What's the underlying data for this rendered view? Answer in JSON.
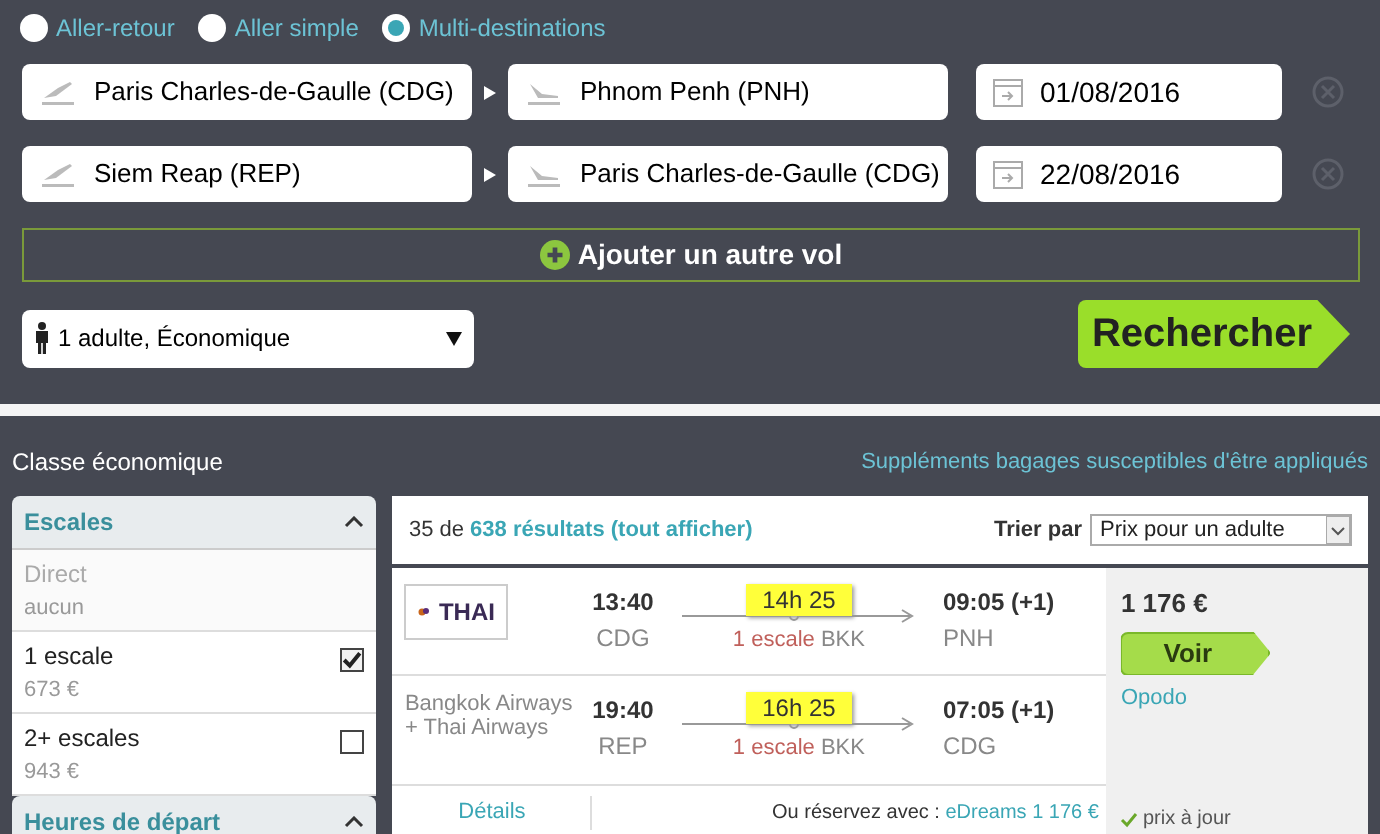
{
  "trip_types": [
    {
      "label": "Aller-retour",
      "selected": false
    },
    {
      "label": "Aller simple",
      "selected": false
    },
    {
      "label": "Multi-destinations",
      "selected": true
    }
  ],
  "flights": [
    {
      "from": "Paris Charles-de-Gaulle (CDG)",
      "to": "Phnom Penh (PNH)",
      "date": "01/08/2016"
    },
    {
      "from": "Siem Reap (REP)",
      "to": "Paris Charles-de-Gaulle (CDG)",
      "date": "22/08/2016"
    }
  ],
  "add_flight": "Ajouter un autre vol",
  "passengers": "1 adulte, Économique",
  "search_button": "Rechercher",
  "cabin_class": "Classe économique",
  "baggage_note": "Suppléments bagages susceptibles d'être appliqués",
  "filters": [
    {
      "title": "Escales",
      "expanded": true,
      "options": [
        {
          "label": "Direct",
          "price": "aucun",
          "disabled": true
        },
        {
          "label": "1 escale",
          "price": "673 €",
          "disabled": false,
          "checked": true
        },
        {
          "label": "2+ escales",
          "price": "943 €",
          "disabled": false,
          "checked": false
        }
      ]
    },
    {
      "title": "Heures de départ",
      "expanded": true
    }
  ],
  "results_count": "35 de",
  "results_link": "638 résultats (tout afficher)",
  "sort": {
    "label": "Trier par",
    "value": "Prix pour un adulte"
  },
  "result": {
    "legs": [
      {
        "airline": "THAI",
        "kind": "logo",
        "dep_time": "13:40",
        "dep_airport": "CDG",
        "duration": "14h 25",
        "stops": "1 escale",
        "via": "BKK",
        "arr_time": "09:05 (+1)",
        "arr_airport": "PNH"
      },
      {
        "airline": "Bangkok Airways + Thai Airways",
        "kind": "text",
        "dep_time": "19:40",
        "dep_airport": "REP",
        "duration": "16h 25",
        "stops": "1 escale",
        "via": "BKK",
        "arr_time": "07:05 (+1)",
        "arr_airport": "CDG"
      }
    ],
    "details": "Détails",
    "alt_label": "Ou réservez avec :",
    "alt_link": "eDreams 1 176 €",
    "price": "1 176 €",
    "button": "Voir",
    "provider": "Opodo",
    "price_status": "prix à jour"
  }
}
